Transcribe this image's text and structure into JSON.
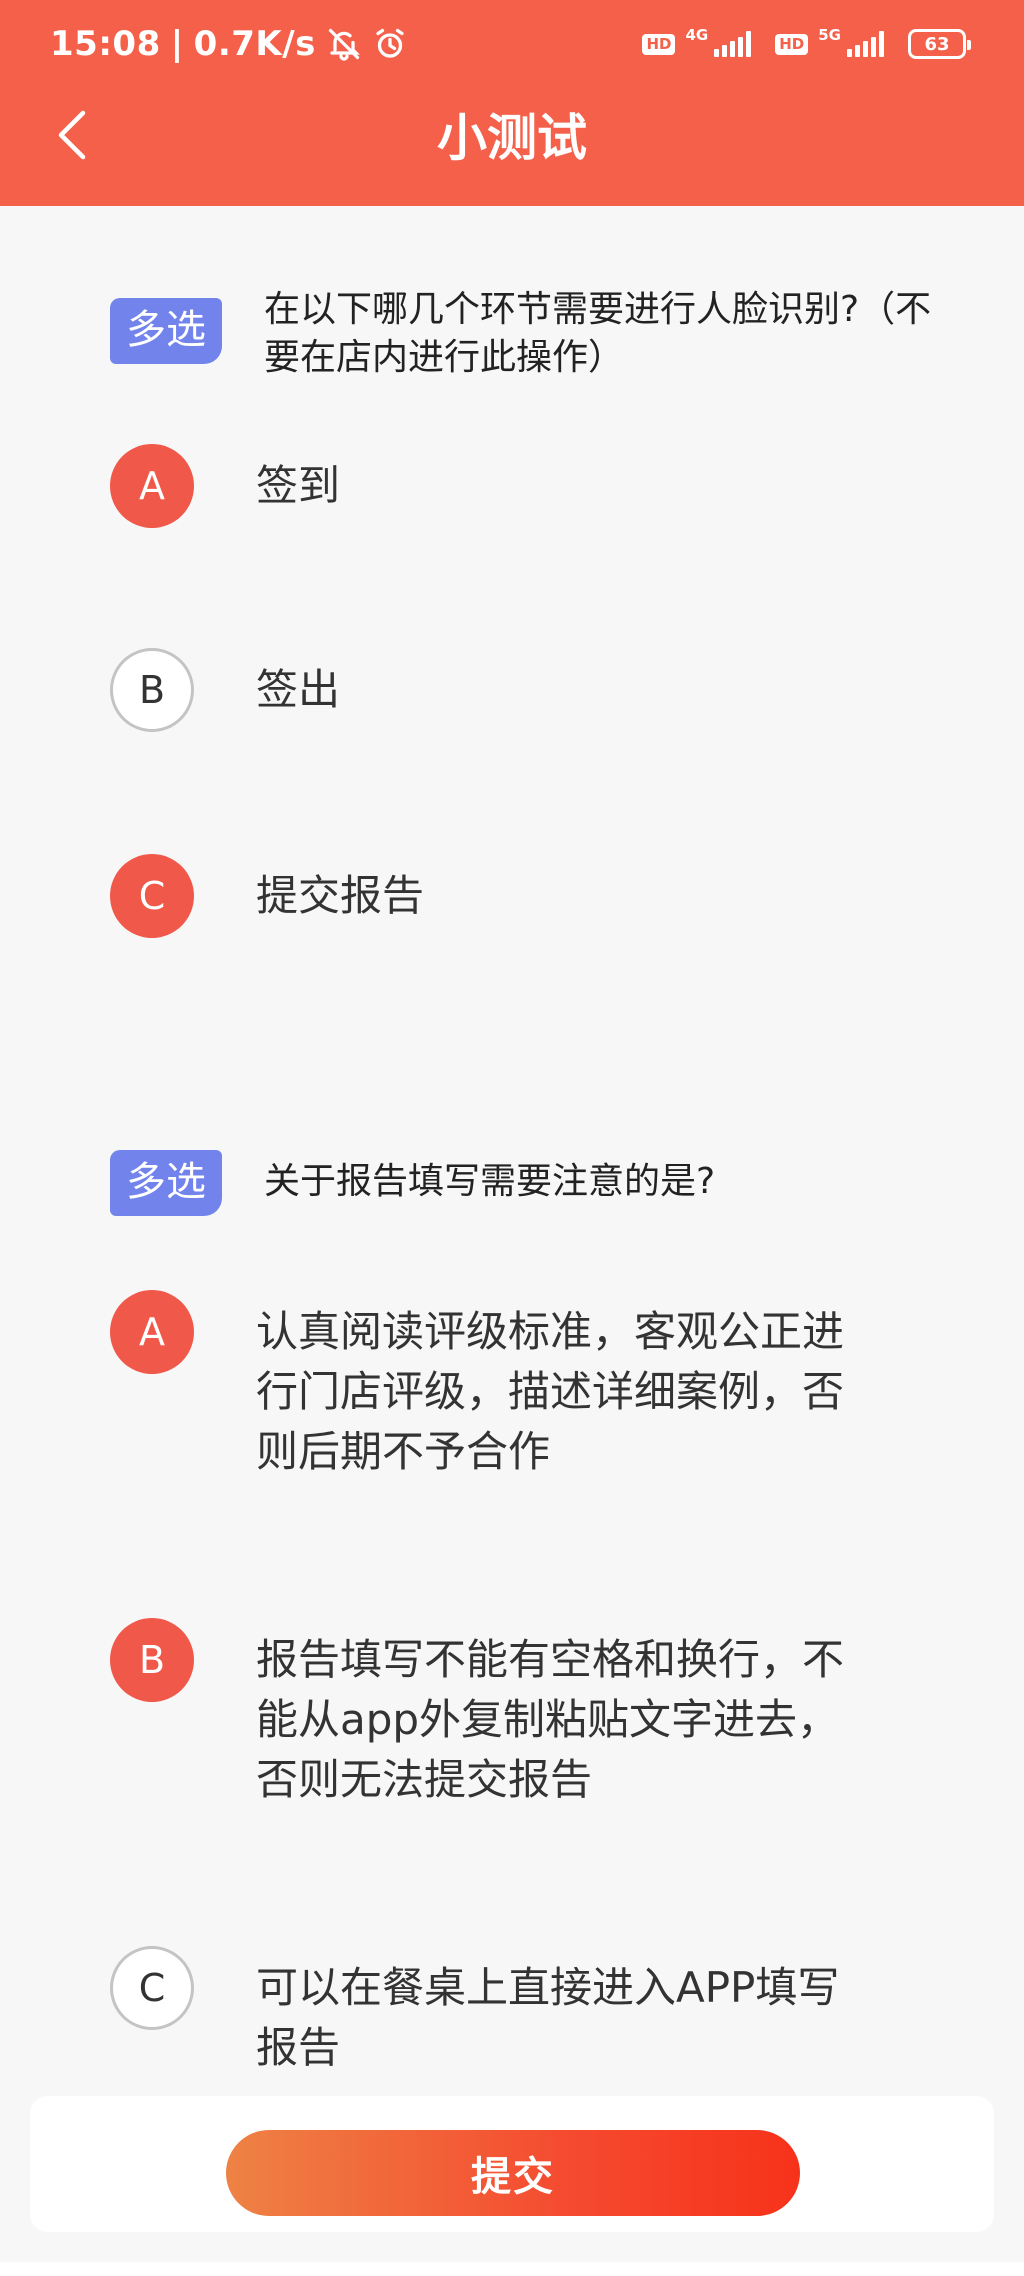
{
  "status_bar": {
    "time": "15:08",
    "net_speed": "0.7K/s",
    "network_1": "4G",
    "network_2": "5G",
    "hd": "HD",
    "battery": "63"
  },
  "nav": {
    "title": "小测试"
  },
  "questions": [
    {
      "tag": "多选",
      "text": "在以下哪几个环节需要进行人脸识别?（不要在店内进行此操作）",
      "options": [
        {
          "letter": "A",
          "text": "签到",
          "selected": true
        },
        {
          "letter": "B",
          "text": "签出",
          "selected": false
        },
        {
          "letter": "C",
          "text": "提交报告",
          "selected": true
        }
      ]
    },
    {
      "tag": "多选",
      "text": "关于报告填写需要注意的是?",
      "options": [
        {
          "letter": "A",
          "text": "认真阅读评级标准，客观公正进行门店评级，描述详细案例，否则后期不予合作",
          "selected": true
        },
        {
          "letter": "B",
          "text": "报告填写不能有空格和换行，不能从app外复制粘贴文字进去，否则无法提交报告",
          "selected": true
        },
        {
          "letter": "C",
          "text": "可以在餐桌上直接进入APP填写报告",
          "selected": false
        }
      ]
    }
  ],
  "footer": {
    "submit_label": "提交"
  },
  "colors": {
    "accent": "#f4604a",
    "tag": "#7284ec",
    "selected": "#f0584a"
  }
}
